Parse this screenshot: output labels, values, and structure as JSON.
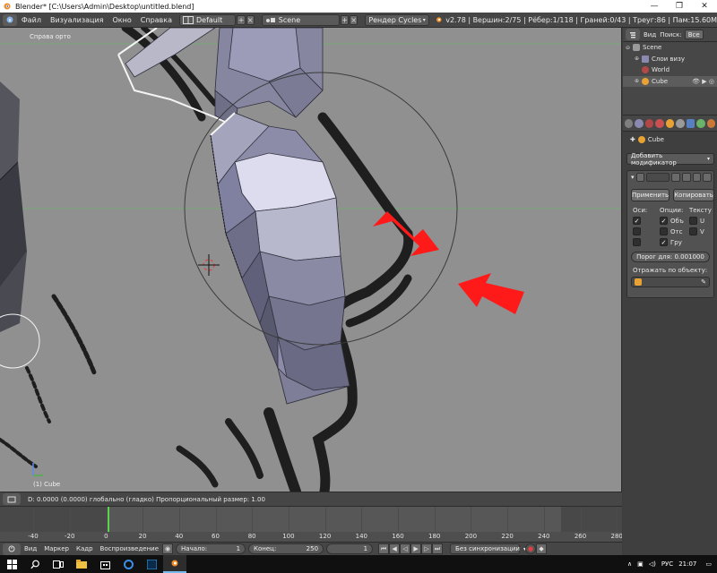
{
  "window": {
    "title": "Blender* [C:\\Users\\Admin\\Desktop\\untitled.blend]",
    "minimize_glyph": "—",
    "maximize_glyph": "❐",
    "close_glyph": "✕"
  },
  "info_header": {
    "menus": [
      "Файл",
      "Визуализация",
      "Окно",
      "Справка"
    ],
    "layout_name": "Default",
    "scene_name": "Scene",
    "render_engine": "Рендер Cycles",
    "stats": "v2.78 | Вершин:2/75 | Рёбер:1/118 | Граней:0/43 | Треуг:86 | Пам:15.60M"
  },
  "viewport": {
    "view_label": "Справа орто",
    "object_label": "(1) Cube"
  },
  "viewport_header": {
    "status": "D: 0.0000 (0.0000) глобально (гладко)   Пропорциональный размер: 1.00"
  },
  "timeline": {
    "ruler_labels": [
      "-40",
      "-20",
      "0",
      "20",
      "40",
      "60",
      "80",
      "100",
      "120",
      "140",
      "160",
      "180",
      "200",
      "220",
      "240",
      "260",
      "280"
    ],
    "current_frame": 1
  },
  "timeline_header": {
    "menus": [
      "Вид",
      "Маркер",
      "Кадр",
      "Воспроизведение"
    ],
    "start_label": "Начало:",
    "start_value": "1",
    "end_label": "Конец:",
    "end_value": "250",
    "current_value": "1",
    "sync": "Без синхронизации"
  },
  "outliner": {
    "view_label": "Вид",
    "search_label": "Поиск:",
    "filter_label": "Все",
    "items": [
      {
        "label": "Scene"
      },
      {
        "label": "Слои визу"
      },
      {
        "label": "World"
      },
      {
        "label": "Cube"
      }
    ]
  },
  "properties": {
    "object_name": "Cube",
    "add_modifier": "Добавить модификатор",
    "apply": "Применить",
    "copy": "Копировать",
    "col_axis": "Оси:",
    "col_options": "Опции:",
    "col_texture": "Тексту",
    "opt_vertex": "Объ",
    "opt_clip": "Отс",
    "opt_group": "Гру",
    "tex_u": "U",
    "tex_v": "V",
    "threshold": "Порог для: 0.001000",
    "mirror_object": "Отражать по объекту:"
  },
  "taskbar": {
    "language": "РУС",
    "time": "21:07"
  },
  "colors": {
    "viewport_bg": "#909090",
    "mesh_light": "#dcdcee",
    "mesh_dark": "#6a6a7e",
    "arrow": "#ff1a1a",
    "timeline_cursor": "#5cd24f",
    "active_tab": "#5680c2"
  }
}
